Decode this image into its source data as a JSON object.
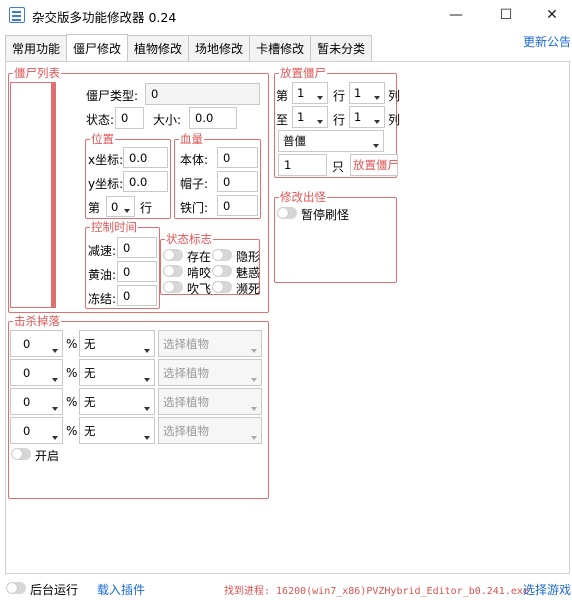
{
  "window": {
    "title": "杂交版多功能修改器  0.24",
    "minimize_glyph": "—",
    "maximize_glyph": "☐",
    "close_glyph": "✕"
  },
  "tabs": [
    {
      "label": "常用功能",
      "active": false
    },
    {
      "label": "僵尸修改",
      "active": true
    },
    {
      "label": "植物修改",
      "active": false
    },
    {
      "label": "场地修改",
      "active": false
    },
    {
      "label": "卡槽修改",
      "active": false
    },
    {
      "label": "暂未分类",
      "active": false
    }
  ],
  "update_link": "更新公告",
  "zombie_list": {
    "title": "僵尸列表",
    "type_label": "僵尸类型:",
    "type_value": "0",
    "state_label": "状态:",
    "state_value": "0",
    "size_label": "大小:",
    "size_value": "0.0"
  },
  "position": {
    "title": "位置",
    "x_label": "x坐标:",
    "x_value": "0.0",
    "y_label": "y坐标:",
    "y_value": "0.0",
    "row_prefix": "第",
    "row_value": "0",
    "row_suffix": "行"
  },
  "health": {
    "title": "血量",
    "body_label": "本体:",
    "body_value": "0",
    "hat_label": "帽子:",
    "hat_value": "0",
    "door_label": "铁门:",
    "door_value": "0"
  },
  "control_time": {
    "title": "控制时间",
    "slow_label": "减速:",
    "slow_value": "0",
    "butter_label": "黄油:",
    "butter_value": "0",
    "freeze_label": "冻结:",
    "freeze_value": "0"
  },
  "status_flags": {
    "title": "状态标志",
    "items": [
      "存在",
      "隐形",
      "啃咬",
      "魅惑",
      "吹飞",
      "濒死"
    ]
  },
  "place_zombie": {
    "title": "放置僵尸",
    "row1_prefix": "第",
    "row1_value": "1",
    "row1_mid": "行",
    "row1_col_value": "1",
    "row1_suffix": "列",
    "row2_prefix": "至",
    "row2_value": "1",
    "row2_mid": "行",
    "row2_col_value": "1",
    "row2_suffix": "列",
    "type_value": "普僵",
    "count_value": "1",
    "count_unit": "只",
    "place_button": "放置僵尸"
  },
  "spawn": {
    "title": "修改出怪",
    "pause_label": "暂停刷怪"
  },
  "kill_drop": {
    "title": "击杀掉落",
    "rows": [
      {
        "percent": "0",
        "drop": "无",
        "plant": "选择植物"
      },
      {
        "percent": "0",
        "drop": "无",
        "plant": "选择植物"
      },
      {
        "percent": "0",
        "drop": "无",
        "plant": "选择植物"
      },
      {
        "percent": "0",
        "drop": "无",
        "plant": "选择植物"
      }
    ],
    "percent_sign": "%",
    "enable_label": "开启"
  },
  "footer": {
    "background_label": "后台运行",
    "load_plugin": "载入插件",
    "process_text": "找到进程: 16200(win7_x86)PVZHybrid_Editor_b0.241.exe",
    "select_game": "选择游戏"
  }
}
